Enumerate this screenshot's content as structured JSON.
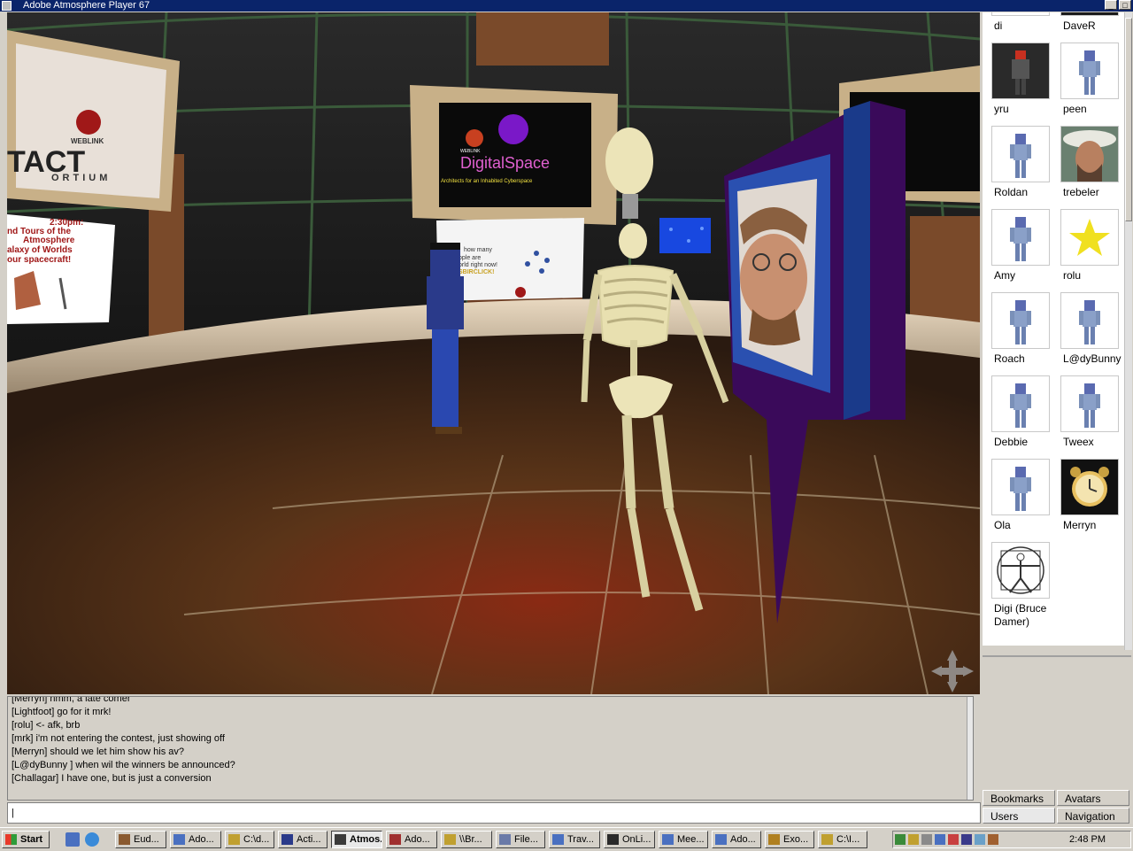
{
  "window": {
    "title": "Adobe Atmosphere Player 67"
  },
  "scene": {
    "posters": {
      "left_top": {
        "brand": "WEBLINK",
        "text_big": "TACT",
        "text_sub": "ORTIUM"
      },
      "center_top": {
        "brand": "WEBLINK",
        "title": "DigitalSpace",
        "subtitle": "Architects for an Inhabited Cyberspace"
      },
      "left_schedule": {
        "lines": [
          "2:30pm:",
          "nd Tours of the",
          "Atmosphere",
          "alaxy of Worlds",
          "our spacecraft!"
        ]
      },
      "center_sign": {
        "lines": [
          "how many",
          "ople are",
          "orld right now!",
          "SBIRCLICK!"
        ]
      }
    }
  },
  "chat": {
    "lines": [
      "[Merryn] hmm, a late comer",
      "[Lightfoot] go for it mrk!",
      "[rolu] <- afk, brb",
      "[mrk] i'm not entering the contest, just showing off",
      "[Merryn] should we let him show his av?",
      "[L@dyBunny ] when wil the winners be announced?",
      "[Challagar] I have one, but is just a conversion"
    ],
    "input_value": "|"
  },
  "users": [
    {
      "name": "di",
      "icon": "blue-avatar-icon"
    },
    {
      "name": "DaveR",
      "icon": "dark-avatar-icon"
    },
    {
      "name": "yru",
      "icon": "robot-avatar-icon"
    },
    {
      "name": "peen",
      "icon": "blue-avatar-icon"
    },
    {
      "name": "Roldan",
      "icon": "blue-avatar-icon"
    },
    {
      "name": "trebeler",
      "icon": "photo-avatar-icon"
    },
    {
      "name": "Amy",
      "icon": "blue-avatar-icon"
    },
    {
      "name": "rolu",
      "icon": "star-avatar-icon"
    },
    {
      "name": "Roach",
      "icon": "blue-avatar-icon"
    },
    {
      "name": "L@dyBunny",
      "icon": "blue-avatar-icon"
    },
    {
      "name": "Debbie",
      "icon": "blue-avatar-icon"
    },
    {
      "name": "Tweex",
      "icon": "blue-avatar-icon"
    },
    {
      "name": "Ola",
      "icon": "blue-avatar-icon"
    },
    {
      "name": "Merryn",
      "icon": "clock-avatar-icon"
    },
    {
      "name": "Digi (Bruce Damer)",
      "icon": "vitruvian-avatar-icon"
    }
  ],
  "tabs": {
    "bookmarks": "Bookmarks",
    "avatars": "Avatars",
    "users": "Users",
    "navigation": "Navigation"
  },
  "taskbar": {
    "start": "Start",
    "buttons": [
      "Eud...",
      "Ado...",
      "C:\\d...",
      "Acti...",
      "Atmos...",
      "Ado...",
      "\\\\Br...",
      "File...",
      "Trav...",
      "OnLi...",
      "Mee...",
      "Ado...",
      "Exo...",
      "C:\\I..."
    ],
    "active_index": 4,
    "clock": "2:48 PM"
  }
}
